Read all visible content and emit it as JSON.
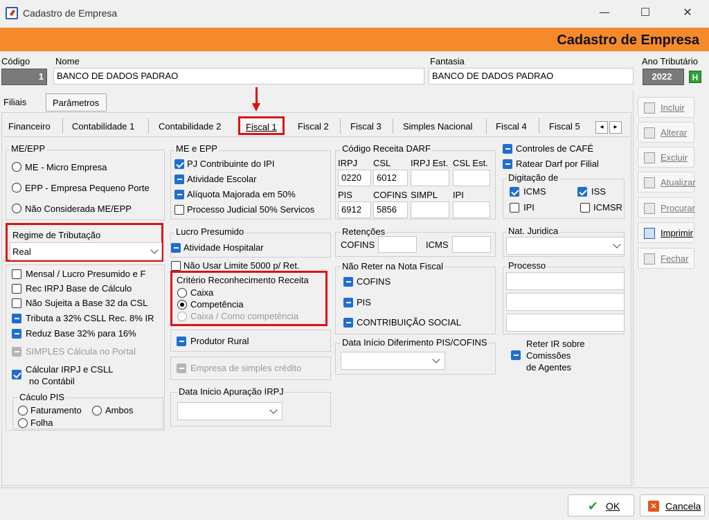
{
  "window": {
    "title": "Cadastro de Empresa",
    "min": "—",
    "max": "☐",
    "close": "✕"
  },
  "banner": {
    "title": "Cadastro de Empresa"
  },
  "header": {
    "codigo_label": "Código",
    "codigo_value": "1",
    "nome_label": "Nome",
    "nome_value": "BANCO DE DADOS PADRAO",
    "fantasia_label": "Fantasia",
    "fantasia_value": "BANCO DE DADOS PADRAO",
    "ano_label": "Ano Tributário",
    "ano_value": "2022",
    "h_button": "H"
  },
  "top_tabs": [
    "Filiais",
    "Parâmetros"
  ],
  "tabs": [
    "Financeiro",
    "Contabilidade 1",
    "Contabilidade 2",
    "Fiscal 1",
    "Fiscal 2",
    "Fiscal 3",
    "Simples Nacional",
    "Fiscal 4",
    "Fiscal 5"
  ],
  "tab_nav": {
    "left": "◂",
    "right": "▸"
  },
  "me_epp": {
    "title": "ME/EPP",
    "options": [
      "ME - Micro Empresa",
      "EPP - Empresa Pequeno Porte",
      "Não Considerada ME/EPP"
    ]
  },
  "regime": {
    "label": "Regime de Tributação",
    "value": "Real"
  },
  "left_checks": [
    "Mensal / Lucro Presumido e F",
    "Rec IRPJ Base de Cálculo",
    "Não Sujeita a Base 32 da CSL",
    "Tributa a 32% CSLL Rec. 8% IR",
    "Reduz Base 32% para 16%",
    "SIMPLES Cálcula  no Portal",
    "Cálcular IRPJ e CSLL",
    "no Contábil"
  ],
  "calculo_pis": {
    "title": "Cáculo PIS",
    "options": [
      "Faturamento",
      "Ambos",
      "Folha"
    ]
  },
  "me_e_epp": {
    "title": "ME e EPP",
    "items": [
      "PJ Contribuinte do IPI",
      "Atividade Escolar",
      "Alíquota Majorada em 50%",
      "Processo Judicial 50% Servicos"
    ]
  },
  "lucro_presumido": {
    "title": "Lucro Presumido",
    "items": [
      "Atividade Hospitalar",
      "Não Usar Limite 5000 p/ Ret."
    ]
  },
  "criterio": {
    "title": "Critério Reconhecimento  Receita",
    "options": [
      "Caixa",
      "Competência",
      "Caixa / Como competência"
    ]
  },
  "produtor_rural": "Produtor Rural",
  "empresa_simples": "Empresa de simples crédito",
  "data_inicio_irpj": "Data Inicio Apuração IRPJ",
  "darf": {
    "title": "Código Receita DARF",
    "labels1": [
      "IRPJ",
      "CSL",
      "IRPJ Est.",
      "CSL Est."
    ],
    "values1": [
      "0220",
      "6012",
      "",
      ""
    ],
    "labels2": [
      "PIS",
      "COFINS",
      "SIMPL",
      "IPI"
    ],
    "values2": [
      "6912",
      "5856",
      "",
      ""
    ]
  },
  "retencoes": {
    "title": "Retenções",
    "cofins": "COFINS",
    "icms": "ICMS"
  },
  "nao_reter": {
    "title": "Não Reter na Nota Fiscal",
    "items": [
      "COFINS",
      "PIS",
      "CONTRIBUIÇÃO SOCIAL"
    ]
  },
  "data_diferimento": "Data Início Diferimento PIS/COFINS",
  "cafe": [
    "Controles de CAFÉ",
    "Ratear Darf por Filial"
  ],
  "digitacao": {
    "title": "Digitação de",
    "items": [
      "ICMS",
      "ISS",
      "IPI",
      "ICMSR"
    ]
  },
  "nat_juridica": "Nat. Juridica",
  "processo": "Processo",
  "reter_ir": [
    "Reter IR sobre",
    "Comissões",
    "de Agentes"
  ],
  "side_buttons": [
    "Incluir",
    "Alterar",
    "Excluir",
    "Atualizar",
    "Procurar",
    "Imprimir",
    "Fechar"
  ],
  "bottom": {
    "ok": "OK",
    "cancel": "Cancela"
  },
  "annotation": {
    "arrow": "↓"
  },
  "colors": {
    "banner": "#f58a2c",
    "check": "#1f6fd0",
    "highlight": "#e01010"
  }
}
